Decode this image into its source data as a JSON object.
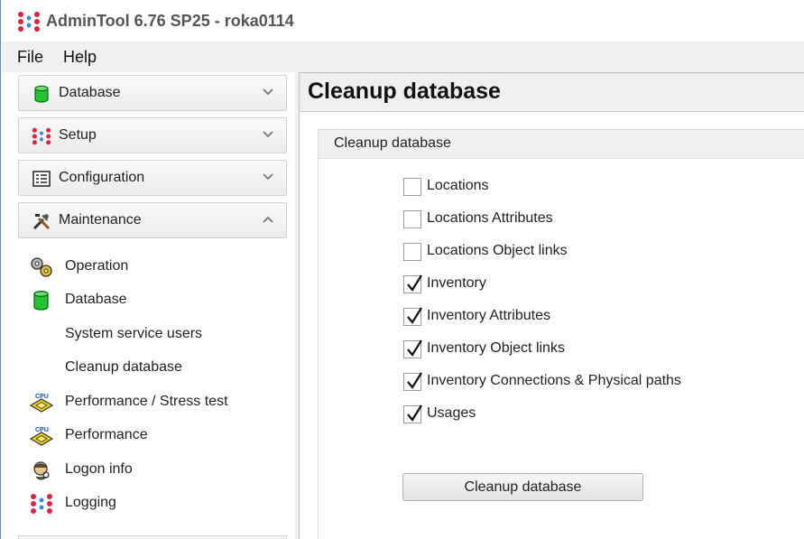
{
  "window": {
    "title": "AdminTool 6.76 SP25 - roka0114"
  },
  "menu": {
    "items": [
      {
        "label": "File"
      },
      {
        "label": "Help"
      }
    ]
  },
  "sidebar": {
    "sections": [
      {
        "label": "Database",
        "icon": "database-icon",
        "expanded": false
      },
      {
        "label": "Setup",
        "icon": "setup-icon",
        "expanded": false
      },
      {
        "label": "Configuration",
        "icon": "configuration-icon",
        "expanded": false
      },
      {
        "label": "Maintenance",
        "icon": "tools-icon",
        "expanded": true
      }
    ],
    "maintenance_items": [
      {
        "label": "Operation",
        "icon": "gears-icon"
      },
      {
        "label": "Database",
        "icon": "database-icon"
      },
      {
        "label": "System service users",
        "icon": ""
      },
      {
        "label": "Cleanup database",
        "icon": ""
      },
      {
        "label": "Performance / Stress test",
        "icon": "cpu-icon"
      },
      {
        "label": "Performance",
        "icon": "cpu-icon"
      },
      {
        "label": "Logon info",
        "icon": "logon-icon"
      },
      {
        "label": "Logging",
        "icon": "logging-icon"
      }
    ]
  },
  "main": {
    "page_title": "Cleanup database",
    "group_title": "Cleanup database",
    "options": [
      {
        "label": "Locations",
        "checked": false
      },
      {
        "label": "Locations Attributes",
        "checked": false
      },
      {
        "label": "Locations Object links",
        "checked": false
      },
      {
        "label": "Inventory",
        "checked": true
      },
      {
        "label": "Inventory Attributes",
        "checked": true
      },
      {
        "label": "Inventory Object links",
        "checked": true
      },
      {
        "label": "Inventory Connections & Physical paths",
        "checked": true
      },
      {
        "label": "Usages",
        "checked": true
      }
    ],
    "action_button_label": "Cleanup database"
  },
  "colors": {
    "logo_red": "#d8264a",
    "logo_blue": "#3a8fd8",
    "database_green": "#22c433",
    "cpu_yellow": "#f3d21a"
  }
}
